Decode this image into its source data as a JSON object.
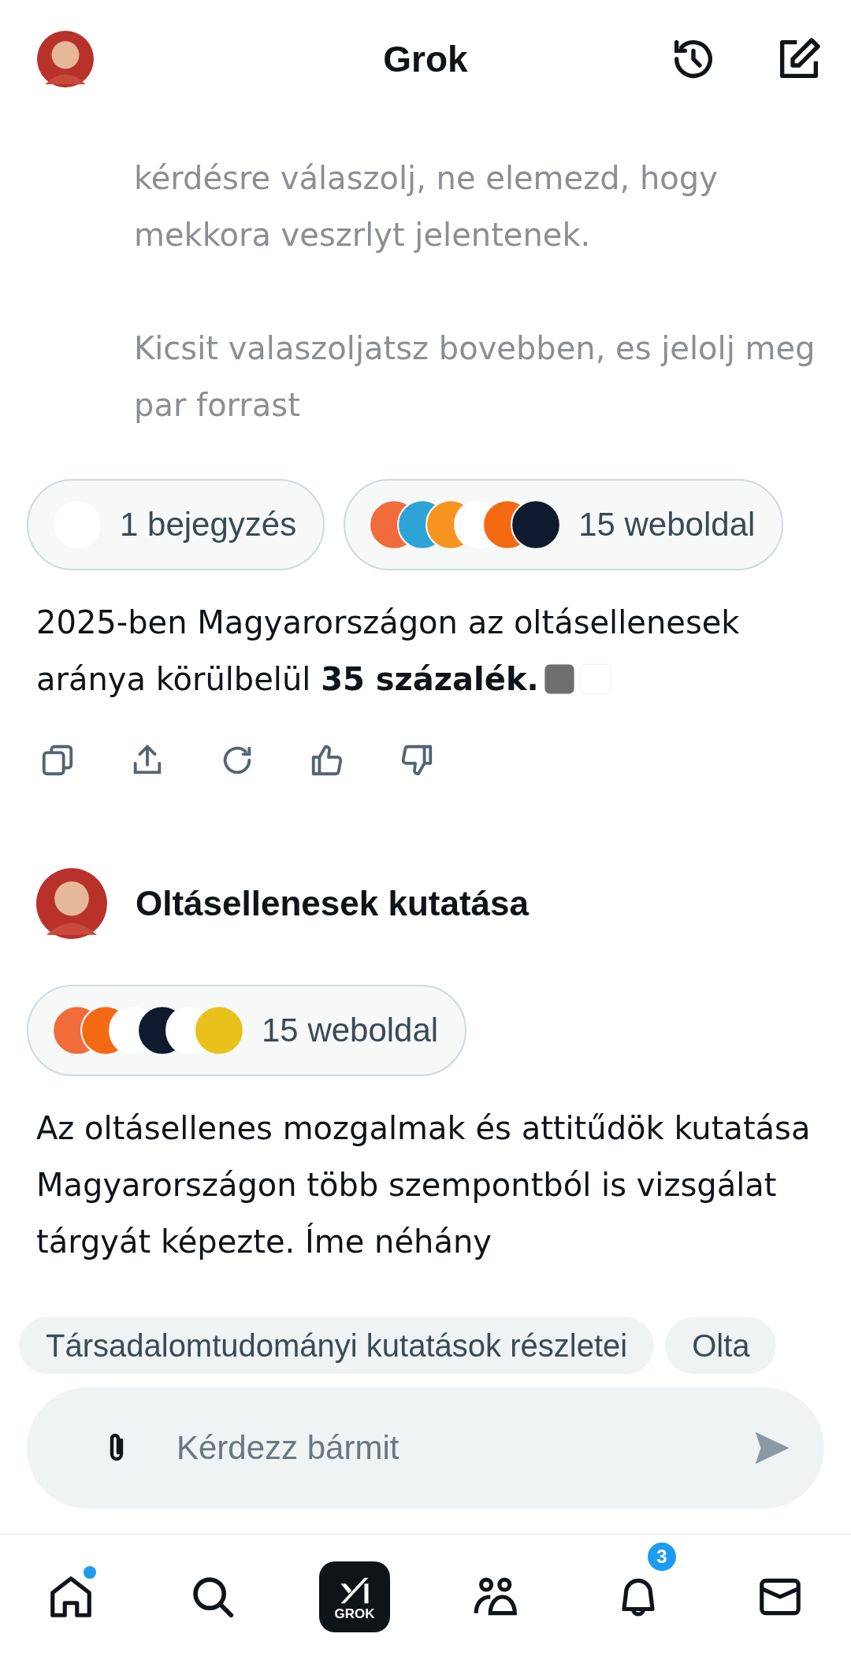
{
  "header": {
    "title": "Grok"
  },
  "messages": [
    {
      "kind": "user",
      "paragraphs": [
        "kérdésre válaszolj, ne elemezd, hogy mekkora veszrlyt jelentenek.",
        "Kicsit valaszoljatsz bovebben, es jelolj meg par forrast"
      ]
    },
    {
      "kind": "sources",
      "chips": [
        {
          "label": "1 bejegyzés",
          "icons": [
            {
              "color": "#ffffff"
            }
          ]
        },
        {
          "label": "15 weboldal",
          "icons": [
            {
              "color": "#f26b3a"
            },
            {
              "color": "#2ea3d6"
            },
            {
              "color": "#f7931e"
            },
            {
              "color": "#ffffff"
            },
            {
              "color": "#f46a12"
            },
            {
              "color": "#0f1a2e"
            }
          ]
        }
      ]
    },
    {
      "kind": "answer",
      "text": "2025-ben Magyarországon az oltásellenesek aránya körülbelül **35 százalék.**",
      "citations": [
        {
          "color": "#6e6e6e"
        },
        {
          "color": "#ffffff"
        }
      ],
      "actions": true
    },
    {
      "kind": "user_title",
      "text": "Oltásellenesek kutatása"
    },
    {
      "kind": "sources",
      "chips": [
        {
          "label": "15 weboldal",
          "icons": [
            {
              "color": "#f26b3a"
            },
            {
              "color": "#f46a12"
            },
            {
              "color": "#ffffff"
            },
            {
              "color": "#0f1a2e"
            },
            {
              "color": "#ffffff"
            },
            {
              "color": "#e8c21a"
            }
          ]
        }
      ]
    },
    {
      "kind": "answer",
      "text": "Az oltásellenes mozgalmak és attitűdök kutatása Magyarországon több szempontból is vizsgálat tárgyát képezte. Íme néhány"
    }
  ],
  "suggestions": [
    "Társadalomtudományi kutatások részletei",
    "Olta"
  ],
  "input": {
    "placeholder": "Kérdezz bármit"
  },
  "nav": [
    {
      "kind": "home",
      "dot": true
    },
    {
      "kind": "search"
    },
    {
      "kind": "grok",
      "label": "GROK"
    },
    {
      "kind": "communities"
    },
    {
      "kind": "notifications",
      "badge": "3"
    },
    {
      "kind": "messages"
    }
  ]
}
